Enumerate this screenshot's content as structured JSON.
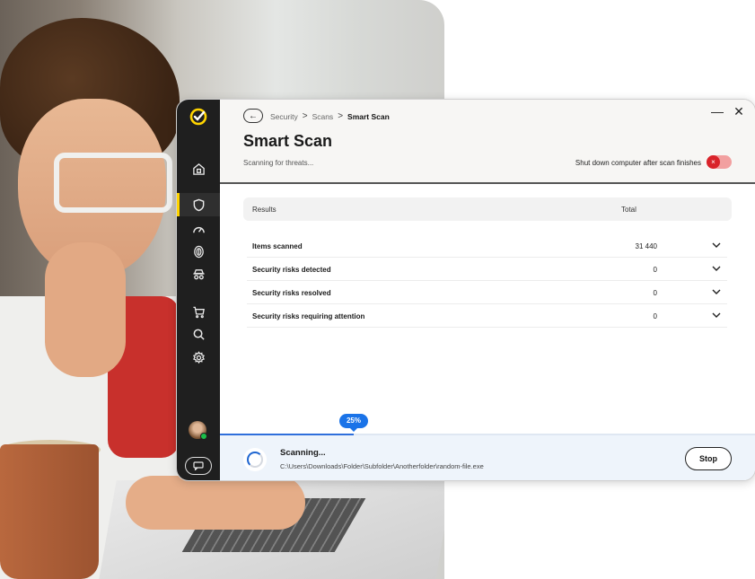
{
  "window": {
    "breadcrumb": [
      "Security",
      "Scans",
      "Smart Scan"
    ],
    "breadcrumb_separator": ">",
    "title": "Smart Scan",
    "subtitle": "Scanning for threats...",
    "minimize_glyph": "—",
    "close_glyph": "✕",
    "back_glyph": "←"
  },
  "sidebar": {
    "items": [
      {
        "icon": "home-lock-icon",
        "active": false
      },
      {
        "icon": "shield-icon",
        "active": true
      },
      {
        "icon": "speedometer-icon",
        "active": false
      },
      {
        "icon": "fingerprint-icon",
        "active": false
      },
      {
        "icon": "incognito-icon",
        "active": false
      },
      {
        "icon": "cart-icon",
        "active": false
      },
      {
        "icon": "search-icon",
        "active": false
      },
      {
        "icon": "gear-icon",
        "active": false
      }
    ],
    "accent_color": "#ffd400",
    "user_status": "online"
  },
  "shutdown": {
    "label": "Shut down computer after scan finishes",
    "enabled": false,
    "knob_glyph": "×",
    "color": "#d9232a"
  },
  "results": {
    "header": {
      "left": "Results",
      "right": "Total"
    },
    "rows": [
      {
        "label": "Items scanned",
        "value": "31 440"
      },
      {
        "label": "Security risks detected",
        "value": "0"
      },
      {
        "label": "Security risks resolved",
        "value": "0"
      },
      {
        "label": "Security risks requiring attention",
        "value": "0"
      }
    ]
  },
  "scan": {
    "progress_percent": 25,
    "progress_label": "25%",
    "status": "Scanning...",
    "current_file": "C:\\Users\\Downloads\\Folder\\Subfolder\\Anotherfolder\\random-file.exe",
    "stop_label": "Stop",
    "accent_color": "#1a73e8"
  }
}
